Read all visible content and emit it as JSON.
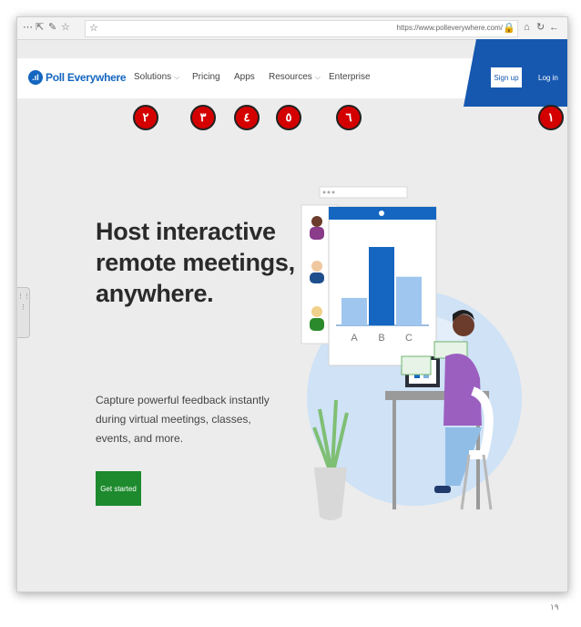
{
  "browser": {
    "url": "https://www.polleverywhere.com/"
  },
  "navbar": {
    "logo_text": "Poll Everywhere",
    "items": [
      {
        "label": "Solutions",
        "has_dropdown": true
      },
      {
        "label": "Pricing",
        "has_dropdown": false
      },
      {
        "label": "Apps",
        "has_dropdown": false
      },
      {
        "label": "Resources",
        "has_dropdown": true
      },
      {
        "label": "Enterprise",
        "has_dropdown": false
      }
    ],
    "signup_label": "Sign up",
    "login_label": "Log in"
  },
  "badges": {
    "login": "١",
    "solutions": "٢",
    "pricing": "٣",
    "apps": "٤",
    "resources": "٥",
    "enterprise": "٦"
  },
  "hero": {
    "title_lines": [
      "Host interactive",
      "remote meetings,",
      "anywhere."
    ],
    "subtitle": "Capture powerful feedback instantly during virtual meetings, classes, events, and more.",
    "cta_label": "Get started"
  },
  "illustration": {
    "chart_categories": [
      "A",
      "B",
      "C"
    ],
    "chart_values": [
      35,
      100,
      62
    ]
  },
  "page_number": "١٩",
  "colors": {
    "brand_blue": "#1466c0",
    "nav_band_blue": "#1658b0",
    "cta_green": "#1d8a2d",
    "badge_red": "#d40000"
  }
}
